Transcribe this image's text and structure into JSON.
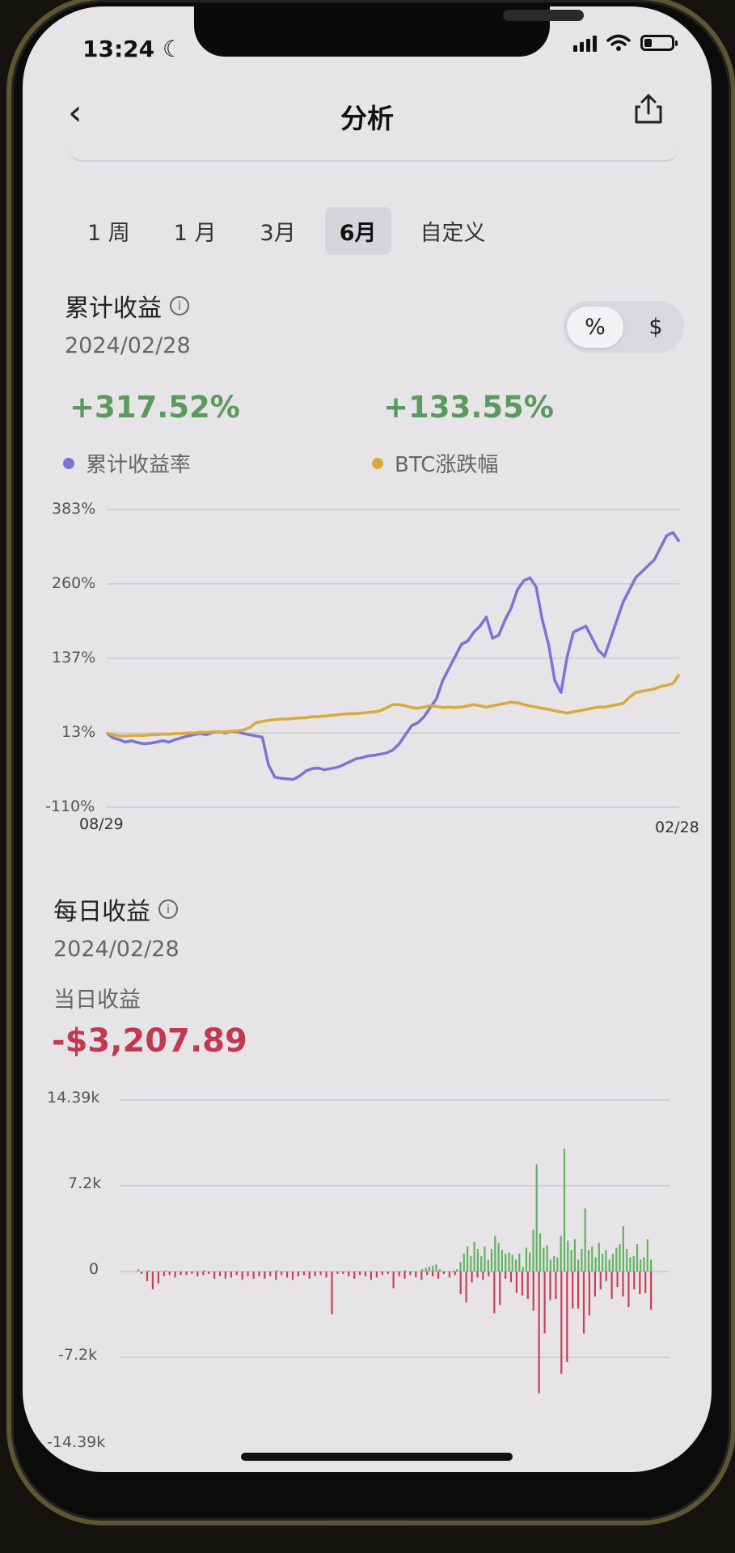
{
  "status": {
    "time": "13:24",
    "moon": "☾"
  },
  "nav": {
    "title": "分析",
    "back": "‹"
  },
  "tabs": [
    "1 周",
    "1 月",
    "3月",
    "6月",
    "自定义"
  ],
  "active_tab": "6月",
  "cumulative": {
    "title": "累计收益",
    "date": "2024/02/28",
    "toggle": [
      "%",
      "$"
    ],
    "toggle_selected": "%",
    "value_strategy": "+317.52%",
    "value_btc": "+133.55%",
    "legend": [
      {
        "label": "累计收益率",
        "color": "#7c74d4"
      },
      {
        "label": "BTC涨跌幅",
        "color": "#d9a93c"
      }
    ]
  },
  "daily": {
    "title": "每日收益",
    "date": "2024/02/28",
    "label": "当日收益",
    "value": "-$3,207.89"
  },
  "chart_data": [
    {
      "type": "line",
      "title": "",
      "x_range": [
        "08/29",
        "02/28"
      ],
      "yticks": [
        "383%",
        "260%",
        "137%",
        "13%",
        "-110%"
      ],
      "ylim": [
        -110,
        383
      ],
      "grid": true,
      "series": [
        {
          "name": "累计收益率",
          "color": "#7c74d4",
          "values": [
            13,
            5,
            2,
            -2,
            0,
            -3,
            -5,
            -4,
            -2,
            0,
            -2,
            2,
            5,
            8,
            10,
            12,
            10,
            14,
            15,
            13,
            16,
            15,
            12,
            10,
            8,
            6,
            -40,
            -60,
            -62,
            -63,
            -64,
            -58,
            -50,
            -46,
            -45,
            -48,
            -46,
            -44,
            -40,
            -35,
            -30,
            -28,
            -25,
            -24,
            -22,
            -20,
            -15,
            -5,
            10,
            25,
            30,
            40,
            55,
            70,
            100,
            120,
            140,
            160,
            165,
            180,
            190,
            205,
            170,
            175,
            200,
            220,
            250,
            265,
            270,
            255,
            200,
            160,
            100,
            80,
            140,
            180,
            185,
            190,
            170,
            150,
            140,
            170,
            200,
            230,
            250,
            270,
            280,
            290,
            300,
            320,
            340,
            345,
            330
          ]
        },
        {
          "name": "BTC涨跌幅",
          "color": "#d9a93c",
          "values": [
            13,
            10,
            8,
            8,
            9,
            9,
            9,
            10,
            10,
            11,
            11,
            12,
            12,
            13,
            13,
            14,
            14,
            15,
            14,
            15,
            16,
            16,
            18,
            22,
            30,
            32,
            34,
            35,
            36,
            36,
            37,
            38,
            38,
            40,
            40,
            41,
            42,
            43,
            44,
            45,
            45,
            46,
            47,
            48,
            50,
            55,
            60,
            60,
            58,
            55,
            54,
            56,
            58,
            57,
            55,
            56,
            55,
            56,
            58,
            60,
            58,
            56,
            58,
            60,
            62,
            64,
            63,
            60,
            58,
            56,
            54,
            52,
            50,
            48,
            46,
            48,
            50,
            52,
            54,
            56,
            56,
            58,
            60,
            62,
            72,
            80,
            82,
            84,
            86,
            90,
            92,
            95,
            110
          ]
        }
      ]
    },
    {
      "type": "bar",
      "title": "",
      "yticks": [
        "14.39k",
        "7.2k",
        "0",
        "-7.2k",
        "-14.39k"
      ],
      "ylim": [
        -14390,
        14390
      ],
      "grid": true,
      "values_pos": [
        200,
        0,
        0,
        100,
        0,
        0,
        0,
        0,
        100,
        0,
        0,
        0,
        0,
        0,
        0,
        0,
        0,
        0,
        0,
        100,
        0,
        0,
        0,
        0,
        0,
        0,
        0,
        0,
        0,
        0,
        0,
        0,
        0,
        0,
        0,
        0,
        0,
        0,
        0,
        0,
        100,
        0,
        0,
        0,
        0,
        0,
        0,
        0,
        0,
        0,
        0,
        0,
        0,
        0,
        0,
        0,
        0,
        0,
        0,
        0,
        0,
        0,
        0,
        0,
        0,
        0,
        0,
        0,
        0,
        0,
        0,
        0,
        0,
        0,
        0,
        0,
        0,
        100,
        0,
        0,
        0,
        0,
        200,
        300,
        400,
        500,
        600,
        200,
        0,
        0,
        0,
        100,
        200,
        800,
        1500,
        2100,
        1300,
        2500,
        1900,
        1300,
        2100,
        1000,
        1900,
        3000,
        2400,
        1800,
        1500,
        1600,
        1400,
        1000,
        1500,
        400,
        2000,
        1600,
        3500,
        9000,
        3200,
        2000,
        2200,
        1000,
        1300,
        1200,
        3000,
        10300,
        2600,
        1800,
        2700,
        1000,
        1900,
        5300,
        1800,
        2100,
        1200,
        2400,
        1500,
        1800,
        1000,
        1500,
        2000,
        2300,
        3800,
        1900,
        1200,
        1300,
        2300,
        1000,
        1200,
        2700,
        1000
      ],
      "values_neg": [
        -200,
        -800,
        -1500,
        -1000,
        -400,
        -300,
        -500,
        -300,
        -300,
        -200,
        -400,
        -300,
        -200,
        -600,
        -400,
        -600,
        -500,
        -300,
        -700,
        -400,
        -600,
        -400,
        -600,
        -400,
        -700,
        -300,
        -500,
        -700,
        -400,
        -300,
        -600,
        -400,
        -300,
        -500,
        -3600,
        -200,
        -200,
        -400,
        -600,
        -300,
        -400,
        -700,
        -500,
        -300,
        -200,
        -1400,
        -400,
        -600,
        -300,
        -500,
        -700,
        -300,
        -400,
        -600,
        -200,
        -500,
        -300,
        -1900,
        -2600,
        -900,
        -500,
        -700,
        -400,
        -3500,
        -2800,
        -600,
        -900,
        -1800,
        -2000,
        -2300,
        -3300,
        -10200,
        -5200,
        -2400,
        -2300,
        -8600,
        -7600,
        -3100,
        -3100,
        -5200,
        -3700,
        -2100,
        -1500,
        -800,
        -2300,
        -1300,
        -2100,
        -3000,
        -1500,
        -1900,
        -1800,
        -3200
      ]
    }
  ]
}
